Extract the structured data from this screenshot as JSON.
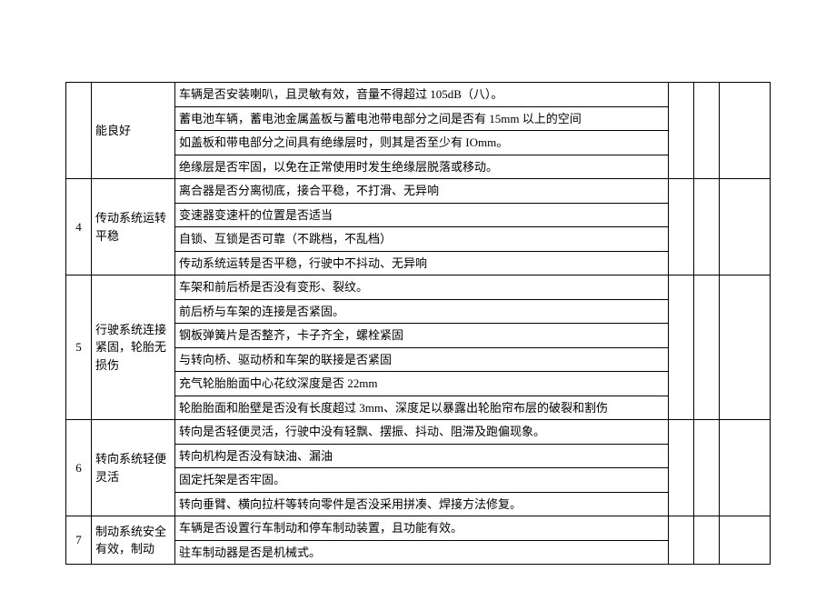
{
  "sections": [
    {
      "num": "",
      "category": "能良好",
      "items": [
        "车辆是否安装喇叭，且灵敏有效，音量不得超过 105dB（八）。",
        "蓄电池车辆，蓄电池金属盖板与蓄电池带电部分之间是否有 15mm 以上的空间",
        "如盖板和带电部分之间具有绝缘层时，则其是否至少有 IOmm。",
        "绝缘层是否牢固，以免在正常使用时发生绝缘层脱落或移动。"
      ]
    },
    {
      "num": "4",
      "category": "传动系统运转平稳",
      "items": [
        "离合器是否分离彻底，接合平稳，不打滑、无异响",
        "变速器变速杆的位置是否适当",
        "自锁、互锁是否可靠（不跳档，不乱档）",
        "传动系统运转是否平稳，行驶中不抖动、无异响"
      ]
    },
    {
      "num": "5",
      "category": "行驶系统连接紧固，轮胎无损伤",
      "items": [
        "车架和前后桥是否没有变形、裂纹。",
        "前后桥与车架的连接是否紧固。",
        "钢板弹簧片是否整齐，卡子齐全，螺栓紧固",
        "与转向桥、驱动桥和车架的联接是否紧固",
        "充气轮胎胎面中心花纹深度是否 22mm",
        "轮胎胎面和胎壁是否没有长度超过 3mm、深度足以暴露出轮胎帘布层的破裂和割伤"
      ]
    },
    {
      "num": "6",
      "category": "转向系统轻便灵活",
      "items": [
        "转向是否轻便灵活，行驶中没有轻飘、摆振、抖动、阻滞及跑偏现象。",
        "转向机构是否没有缺油、漏油",
        "固定托架是否牢固。",
        "转向垂臂、横向拉杆等转向零件是否没采用拼凑、焊接方法修复。"
      ]
    },
    {
      "num": "7",
      "category": "制动系统安全有效，制动",
      "items": [
        "车辆是否设置行车制动和停车制动装置，且功能有效。",
        "驻车制动器是否是机械式。"
      ]
    }
  ]
}
